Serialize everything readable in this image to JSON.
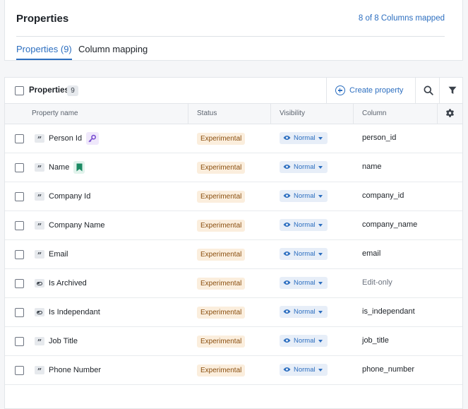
{
  "header": {
    "title": "Properties",
    "mapped_status": "8 of 8 Columns mapped",
    "tabs": [
      {
        "label": "Properties (9)",
        "active": true
      },
      {
        "label": "Column mapping",
        "active": false
      }
    ]
  },
  "toolbar": {
    "label": "Properties",
    "count": "9",
    "create_label": "Create property",
    "search_icon": "search-icon",
    "filter_icon": "filter-icon"
  },
  "columns": {
    "name": "Property name",
    "status": "Status",
    "visibility": "Visibility",
    "column": "Column",
    "settings_icon": "gear-icon"
  },
  "colors": {
    "accent": "#2d6fc0",
    "status_bg": "#fbeedd",
    "status_text": "#8a4f10",
    "key_badge": "#7a4fd1",
    "bookmark_badge": "#1c8a63"
  },
  "rows": [
    {
      "type": "string",
      "name": "Person Id",
      "badge": "key",
      "status": "Experimental",
      "visibility": "Normal",
      "column": "person_id",
      "column_muted": false
    },
    {
      "type": "string",
      "name": "Name",
      "badge": "bookmark",
      "status": "Experimental",
      "visibility": "Normal",
      "column": "name",
      "column_muted": false
    },
    {
      "type": "string",
      "name": "Company Id",
      "badge": "",
      "status": "Experimental",
      "visibility": "Normal",
      "column": "company_id",
      "column_muted": false
    },
    {
      "type": "string",
      "name": "Company Name",
      "badge": "",
      "status": "Experimental",
      "visibility": "Normal",
      "column": "company_name",
      "column_muted": false
    },
    {
      "type": "string",
      "name": "Email",
      "badge": "",
      "status": "Experimental",
      "visibility": "Normal",
      "column": "email",
      "column_muted": false
    },
    {
      "type": "boolean",
      "name": "Is Archived",
      "badge": "",
      "status": "Experimental",
      "visibility": "Normal",
      "column": "Edit-only",
      "column_muted": true
    },
    {
      "type": "boolean",
      "name": "Is Independant",
      "badge": "",
      "status": "Experimental",
      "visibility": "Normal",
      "column": "is_independant",
      "column_muted": false
    },
    {
      "type": "string",
      "name": "Job Title",
      "badge": "",
      "status": "Experimental",
      "visibility": "Normal",
      "column": "job_title",
      "column_muted": false
    },
    {
      "type": "string",
      "name": "Phone Number",
      "badge": "",
      "status": "Experimental",
      "visibility": "Normal",
      "column": "phone_number",
      "column_muted": false
    }
  ]
}
